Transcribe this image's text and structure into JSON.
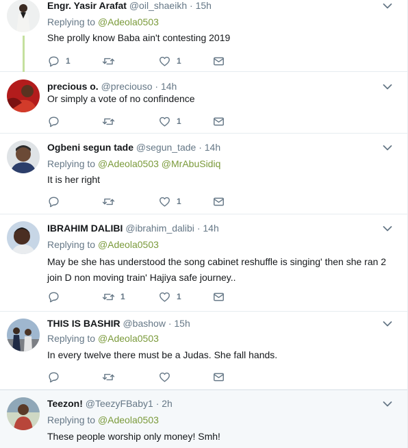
{
  "tweets": [
    {
      "name": "Engr. Yasir Arafat",
      "handle": "@oil_shaeikh",
      "dot": "·",
      "time": "15h",
      "replying_prefix": "Replying to ",
      "mentions": [
        "@Adeola0503"
      ],
      "text": "She prolly know Baba ain't contesting 2019",
      "reply_count": "1",
      "retweet_count": "",
      "like_count": "1"
    },
    {
      "name": "precious o.",
      "handle": "@preciouso",
      "dot": "·",
      "time": "14h",
      "text": "Or simply a vote of no confindence",
      "reply_count": "",
      "retweet_count": "",
      "like_count": "1"
    },
    {
      "name": "Ogbeni segun tade",
      "handle": "@segun_tade",
      "dot": "·",
      "time": "14h",
      "replying_prefix": "Replying to ",
      "mentions": [
        "@Adeola0503",
        "@MrAbuSidiq"
      ],
      "text": "It is her right",
      "reply_count": "",
      "retweet_count": "",
      "like_count": "1"
    },
    {
      "name": "IBRAHIM DALIBI",
      "handle": "@ibrahim_dalibi",
      "dot": "·",
      "time": "14h",
      "replying_prefix": "Replying to ",
      "mentions": [
        "@Adeola0503"
      ],
      "text_line1": "May be she has understood the song cabinet reshuffle is singing' then she ran 2",
      "text_line2": "join D non moving train' Hajiya safe journey..",
      "reply_count": "",
      "retweet_count": "1",
      "like_count": "1"
    },
    {
      "name": "THIS IS BASHIR",
      "handle": "@bashow",
      "dot": "·",
      "time": "15h",
      "replying_prefix": "Replying to ",
      "mentions": [
        "@Adeola0503"
      ],
      "text": "In every twelve there must be a Judas. She fall hands.",
      "reply_count": "",
      "retweet_count": "",
      "like_count": ""
    },
    {
      "name": "Teezon!",
      "handle": "@TeezyFBaby1",
      "dot": "·",
      "time": "2h",
      "replying_prefix": "Replying to ",
      "mentions": [
        "@Adeola0503"
      ],
      "text": "These people worship only money! Smh!"
    }
  ],
  "icons": {
    "reply": "reply-icon",
    "retweet": "retweet-icon",
    "like": "heart-icon",
    "message": "direct-message-icon",
    "caret": "chevron-down-icon"
  },
  "colors": {
    "mention": "#7a9a3a",
    "thread_line": "#c4e09e",
    "secondary_text": "#657786",
    "highlight_bg": "#f5f8fa"
  }
}
